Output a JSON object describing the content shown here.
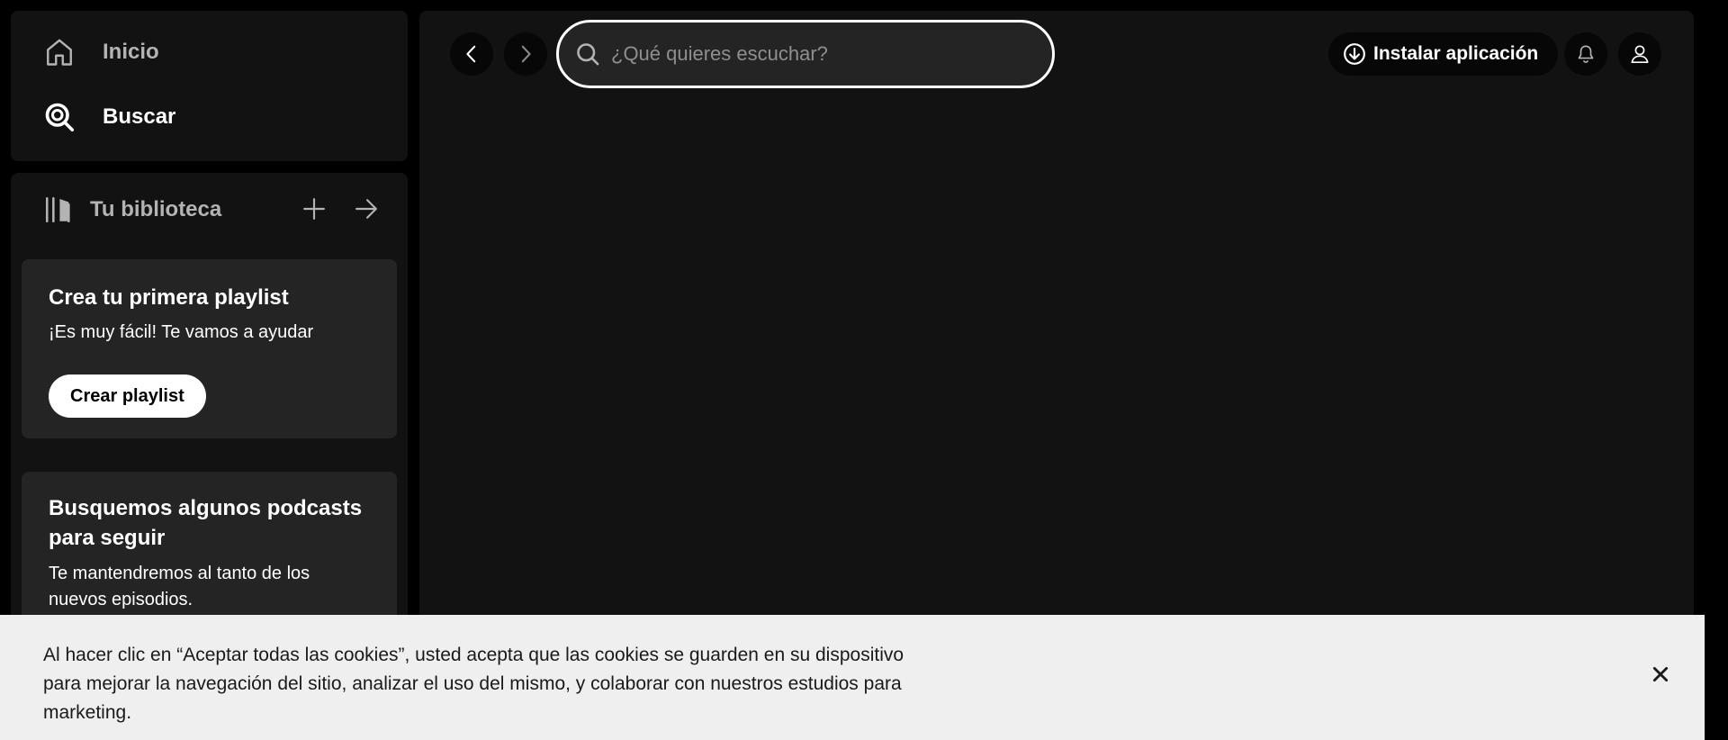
{
  "nav": {
    "home_label": "Inicio",
    "search_label": "Buscar",
    "home_icon": "home-icon",
    "search_icon": "search-icon"
  },
  "library": {
    "title": "Tu biblioteca",
    "icon": "library-icon",
    "add_icon": "plus-icon",
    "expand_icon": "arrow-right-icon",
    "cards": [
      {
        "title": "Crea tu primera playlist",
        "text": "¡Es muy fácil! Te vamos a ayudar",
        "button_label": "Crear playlist"
      },
      {
        "title": "Busquemos algunos podcasts para seguir",
        "text": "Te mantendremos al tanto de los nuevos episodios."
      }
    ]
  },
  "header": {
    "back_icon": "chevron-left-icon",
    "forward_icon": "chevron-right-icon",
    "search_placeholder": "¿Qué quieres escuchar?",
    "install_label": "Instalar aplicación",
    "install_icon": "download-icon",
    "bell_icon": "bell-icon",
    "user_icon": "user-icon"
  },
  "cookie_banner": {
    "text": "Al hacer clic en “Aceptar todas las cookies”, usted acepta que las cookies se guarden en su dispositivo para mejorar la navegación del sitio, analizar el uso del mismo, y colaborar con nuestros estudios para marketing.",
    "close_icon": "close-icon"
  },
  "colors": {
    "background": "#000000",
    "panel": "#121212",
    "card": "#242424",
    "text_primary": "#ffffff",
    "text_secondary": "#b3b3b3",
    "banner": "#efefef"
  }
}
